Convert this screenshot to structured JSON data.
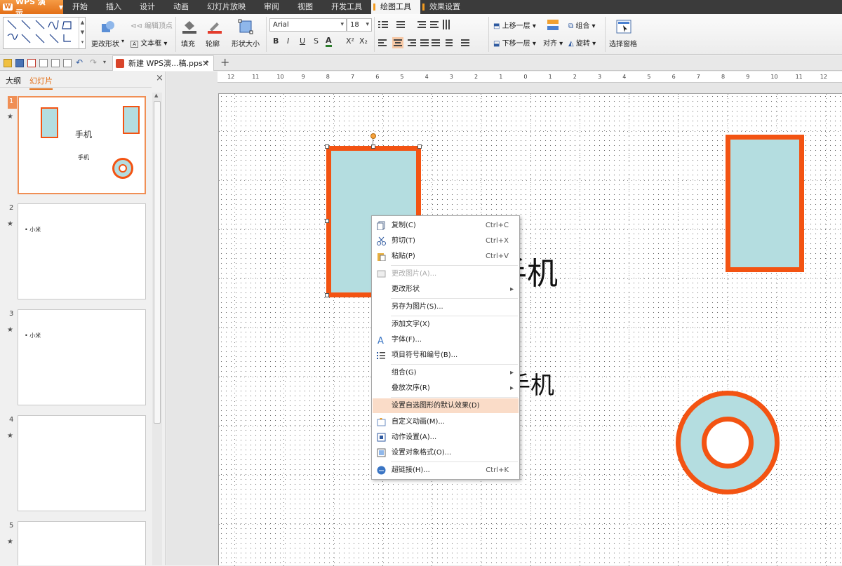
{
  "menubar": {
    "app": "WPS 演示",
    "items": [
      "开始",
      "插入",
      "设计",
      "动画",
      "幻灯片放映",
      "审阅",
      "视图",
      "开发工具",
      "绘图工具",
      "效果设置"
    ]
  },
  "ribbon": {
    "change_shape": "更改形状",
    "edit_points": "编辑顶点",
    "text_box": "文本框",
    "fill": "填充",
    "outline": "轮廓",
    "shape_size": "形状大小",
    "font_name": "Arial",
    "font_size": "18",
    "bring_forward": "上移一层",
    "send_backward": "下移一层",
    "group": "组合",
    "align": "对齐",
    "rotate": "旋转",
    "selection_pane": "选择窗格"
  },
  "doc_tab": {
    "title": "新建 WPS演...稿.pps *",
    "close": "×",
    "new": "+"
  },
  "left_panel": {
    "tab_outline": "大纲",
    "tab_slides": "幻灯片",
    "close": "×",
    "slides": [
      {
        "num": "1",
        "title": "手机",
        "subtitle": "手机"
      },
      {
        "num": "2",
        "bullet": "小米"
      },
      {
        "num": "3",
        "bullet": "小米"
      },
      {
        "num": "4"
      },
      {
        "num": "5"
      }
    ]
  },
  "ruler": {
    "ticks": [
      "12",
      "11",
      "10",
      "9",
      "8",
      "7",
      "6",
      "5",
      "4",
      "3",
      "2",
      "1",
      "0",
      "1",
      "2",
      "3",
      "4",
      "5",
      "6",
      "7",
      "8",
      "9",
      "10",
      "11",
      "12"
    ]
  },
  "canvas": {
    "title_text": "手机",
    "sub_text": "手机"
  },
  "context_menu": [
    {
      "label": "复制(C)",
      "shortcut": "Ctrl+C",
      "icon": "copy-icon"
    },
    {
      "label": "剪切(T)",
      "shortcut": "Ctrl+X",
      "icon": "cut-icon"
    },
    {
      "label": "粘贴(P)",
      "shortcut": "Ctrl+V",
      "icon": "paste-icon"
    },
    {
      "label": "更改图片(A)...",
      "disabled": true,
      "icon": "image-icon"
    },
    {
      "label": "更改形状",
      "submenu": true
    },
    {
      "label": "另存为图片(S)..."
    },
    {
      "label": "添加文字(X)"
    },
    {
      "label": "字体(F)...",
      "icon": "font-icon"
    },
    {
      "label": "项目符号和编号(B)...",
      "icon": "bullets-icon"
    },
    {
      "label": "组合(G)",
      "submenu": true
    },
    {
      "label": "叠放次序(R)",
      "submenu": true
    },
    {
      "label": "设置自选图形的默认效果(D)",
      "highlighted": true
    },
    {
      "label": "自定义动画(M)...",
      "icon": "animation-icon"
    },
    {
      "label": "动作设置(A)...",
      "icon": "action-icon"
    },
    {
      "label": "设置对象格式(O)...",
      "icon": "format-icon"
    },
    {
      "label": "超链接(H)...",
      "shortcut": "Ctrl+K",
      "icon": "hyperlink-icon"
    }
  ],
  "colors": {
    "accent": "#f35312",
    "shape_fill": "#b4dde0",
    "highlight": "#fadcc8"
  }
}
